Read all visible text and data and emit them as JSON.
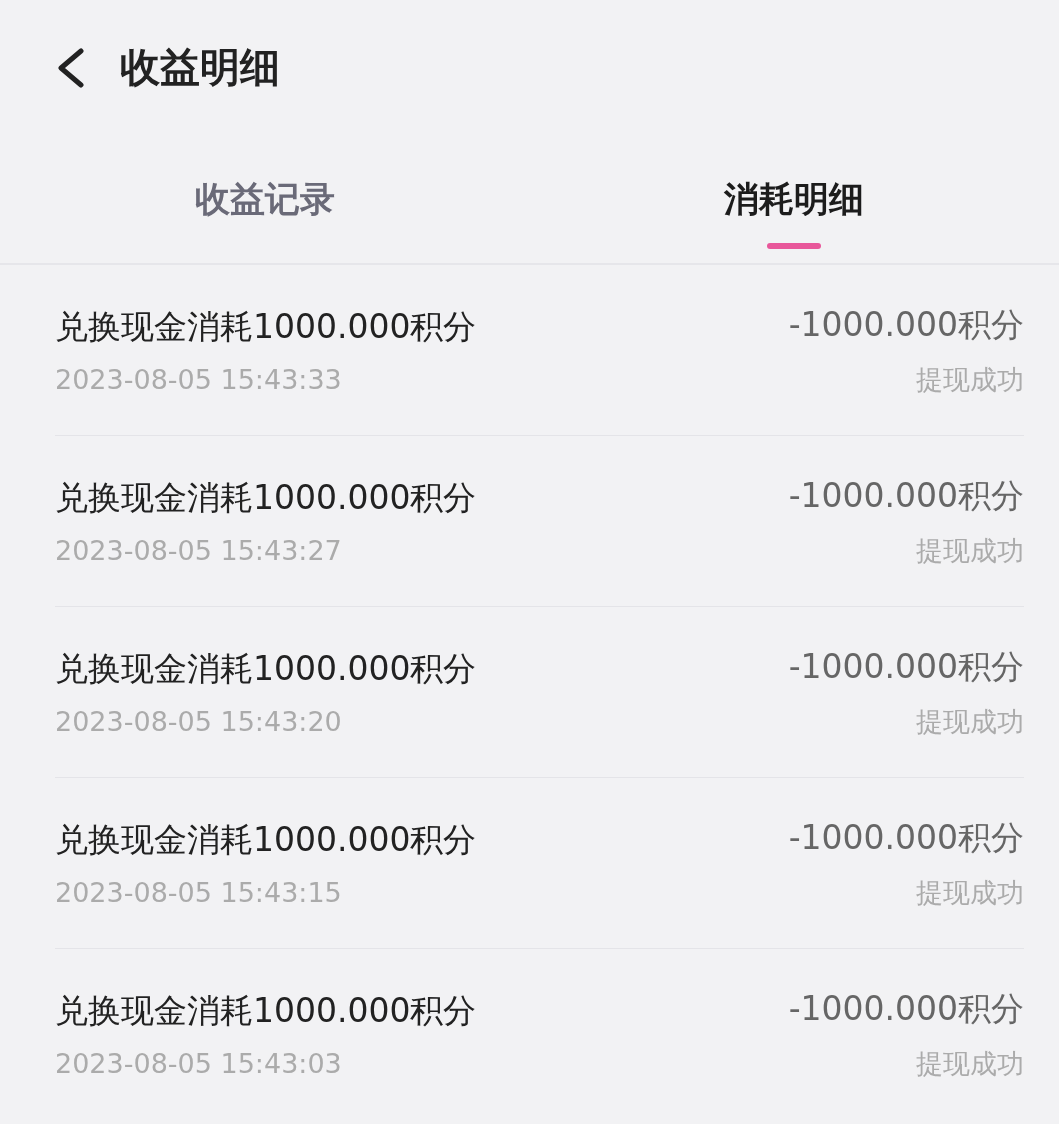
{
  "header": {
    "title": "收益明细"
  },
  "tabs": [
    {
      "label": "收益记录",
      "selected": false
    },
    {
      "label": "消耗明细",
      "selected": true
    }
  ],
  "records": [
    {
      "title": "兑换现金消耗1000.000积分",
      "time": "2023-08-05 15:43:33",
      "amount": "-1000.000积分",
      "status": "提现成功"
    },
    {
      "title": "兑换现金消耗1000.000积分",
      "time": "2023-08-05 15:43:27",
      "amount": "-1000.000积分",
      "status": "提现成功"
    },
    {
      "title": "兑换现金消耗1000.000积分",
      "time": "2023-08-05 15:43:20",
      "amount": "-1000.000积分",
      "status": "提现成功"
    },
    {
      "title": "兑换现金消耗1000.000积分",
      "time": "2023-08-05 15:43:15",
      "amount": "-1000.000积分",
      "status": "提现成功"
    },
    {
      "title": "兑换现金消耗1000.000积分",
      "time": "2023-08-05 15:43:03",
      "amount": "-1000.000积分",
      "status": "提现成功"
    }
  ]
}
